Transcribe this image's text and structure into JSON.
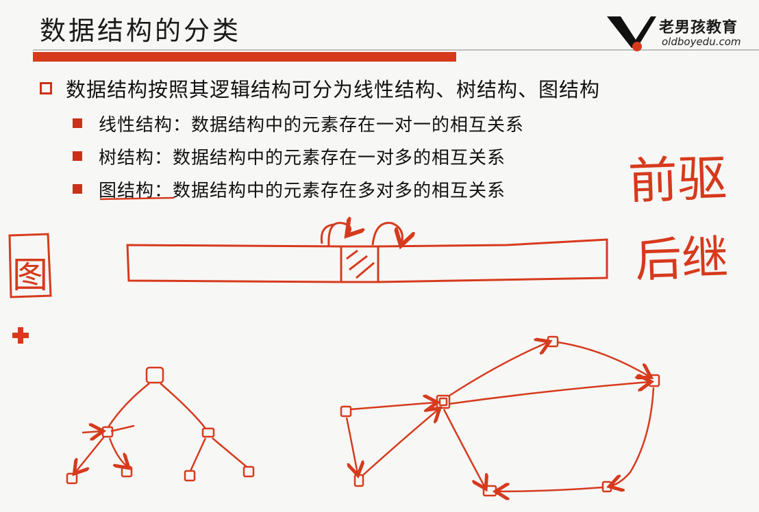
{
  "slide": {
    "title": "数据结构的分类",
    "logo": {
      "name": "老男孩教育",
      "url": "oldboyedu.com"
    },
    "main_bullet": "数据结构按照其逻辑结构可分为线性结构、树结构、图结构",
    "sub_bullets": [
      {
        "term": "线性结构",
        "desc": "：数据结构中的元素存在一对一的相互关系"
      },
      {
        "term": "树结构",
        "desc": "：数据结构中的元素存在一对多的相互关系"
      },
      {
        "term": "图结构",
        "desc": "：数据结构中的元素存在多对多的相互关系"
      }
    ]
  },
  "annotations": {
    "predecessor": "前驱",
    "successor": "后继",
    "graph_char": "图"
  },
  "colors": {
    "accent": "#d63a1c",
    "text": "#111111",
    "background": "#f7f7f6"
  }
}
